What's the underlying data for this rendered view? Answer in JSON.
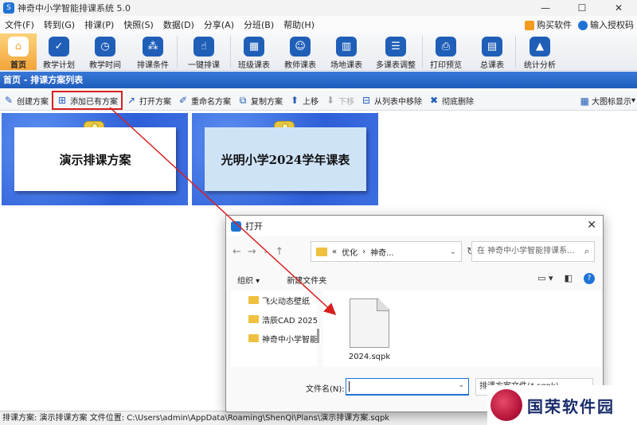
{
  "window": {
    "title": "神奇中小学智能排课系统 5.0",
    "controls": [
      "—",
      "☐",
      "✕"
    ]
  },
  "menu": {
    "items": [
      "文件(F)",
      "转到(G)",
      "排课(P)",
      "快照(S)",
      "数据(D)",
      "分享(A)",
      "分班(B)",
      "帮助(H)"
    ],
    "buy": "购买软件",
    "license": "输入授权码"
  },
  "ribbon": [
    {
      "label": "首页",
      "icon": "home-icon",
      "glyph": "⌂"
    },
    {
      "label": "教学计划",
      "icon": "clipboard-icon",
      "glyph": "✓"
    },
    {
      "label": "教学时间",
      "icon": "clock-icon",
      "glyph": "◷"
    },
    {
      "label": "排课条件",
      "icon": "grid-icon",
      "glyph": "⁂"
    },
    {
      "label": "一键排课",
      "icon": "click-icon",
      "glyph": "☝"
    },
    {
      "label": "班级课表",
      "icon": "calendar-icon",
      "glyph": "▦"
    },
    {
      "label": "教师课表",
      "icon": "teacher-icon",
      "glyph": "☺"
    },
    {
      "label": "场地课表",
      "icon": "building-icon",
      "glyph": "▥"
    },
    {
      "label": "多课表调整",
      "icon": "adjust-icon",
      "glyph": "☰"
    },
    {
      "label": "打印预览",
      "icon": "printer-icon",
      "glyph": "⎙"
    },
    {
      "label": "总课表",
      "icon": "schedule-icon",
      "glyph": "▤"
    },
    {
      "label": "统计分析",
      "icon": "chart-icon",
      "glyph": "▲"
    }
  ],
  "panel": {
    "title": "首页 - 排课方案列表"
  },
  "toolbar": {
    "create": "创建方案",
    "add_existing": "添加已有方案",
    "open": "打开方案",
    "rename": "重命名方案",
    "copy": "复制方案",
    "up": "上移",
    "down": "下移",
    "remove": "从列表中移除",
    "delete": "彻底删除",
    "view": "大图标显示"
  },
  "plans": [
    {
      "name": "演示排课方案"
    },
    {
      "name": "光明小学2024学年课表"
    }
  ],
  "status": {
    "text": "排课方案: 演示排课方案    文件位置: C:\\Users\\admin\\AppData\\Roaming\\ShenQi\\Plans\\演示排课方案.sqpk"
  },
  "dialog": {
    "title": "打开",
    "close": "✕",
    "breadcrumb": [
      "«",
      "优化",
      "›",
      "神奇..."
    ],
    "search_placeholder": "在 神奇中小学智能排课系... ",
    "organize": "组织 ▾",
    "new_folder": "新建文件夹",
    "nav_items": [
      "飞火动态壁纸",
      "浩辰CAD 2025",
      "神奇中小学智能"
    ],
    "file_name": "2024.sqpk",
    "file_label": "文件名(N):",
    "file_value": "",
    "type_label": "排课方案文件(*.sqpk)"
  },
  "watermark": {
    "text": "国荣软件园"
  }
}
